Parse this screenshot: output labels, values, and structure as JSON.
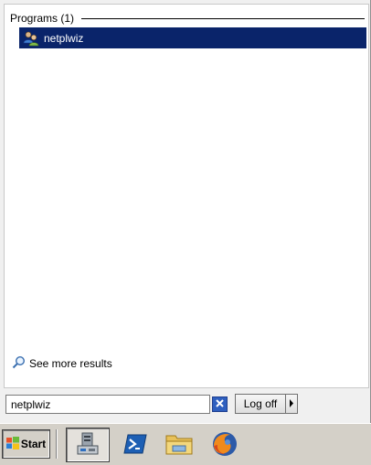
{
  "results": {
    "group_title": "Programs (1)",
    "items": [
      {
        "label": "netplwiz",
        "icon": "users-icon"
      }
    ],
    "see_more_label": "See more results"
  },
  "search": {
    "value": "netplwiz"
  },
  "power": {
    "logoff_label": "Log off"
  },
  "taskbar": {
    "start_label": "Start",
    "pinned": [
      {
        "icon": "server-manager-icon"
      },
      {
        "icon": "powershell-icon"
      },
      {
        "icon": "file-explorer-icon"
      },
      {
        "icon": "firefox-icon"
      }
    ]
  },
  "colors": {
    "selection": "#0a246a",
    "taskbar": "#d4d0c8",
    "menu_bg": "#f0f0f0"
  }
}
